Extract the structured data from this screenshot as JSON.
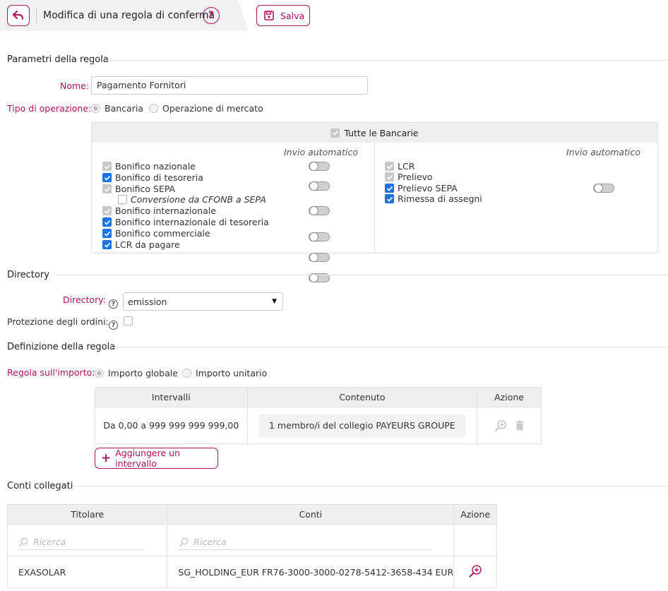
{
  "header": {
    "title": "Modifica di una regola di conferma",
    "help_icon_glyph": "?",
    "save_label": "Salva"
  },
  "rule_params": {
    "section_title": "Parametri della regola",
    "name_label": "Nome:",
    "name_value": "Pagamento Fornitori",
    "op_type_label": "Tipo di operazione:",
    "op_type_options": [
      "Bancaria",
      "Operazione di mercato"
    ],
    "op_type_selected": "Bancaria"
  },
  "operations": {
    "all_label": "Tutte le Bancarie",
    "invio_label": "Invio automatico",
    "left": [
      {
        "label": "Bonifico nazionale",
        "state": "disabled",
        "toggle": true
      },
      {
        "label": "Bonifico di tesoreria",
        "state": "checked",
        "toggle": true
      },
      {
        "label": "Bonifico SEPA",
        "state": "disabled",
        "toggle": true
      },
      {
        "label": "Conversione da CFONB a SEPA",
        "state": "empty",
        "toggle": false
      },
      {
        "label": "Bonifico internazionale",
        "state": "disabled",
        "toggle": true
      },
      {
        "label": "Bonifico internazionale di tesoreria",
        "state": "checked",
        "toggle": true
      },
      {
        "label": "Bonifico commerciale",
        "state": "checked",
        "toggle": true
      },
      {
        "label": "LCR da pagare",
        "state": "checked",
        "toggle": false
      }
    ],
    "right": [
      {
        "label": "LCR",
        "state": "disabled",
        "toggle": false
      },
      {
        "label": "Prelievo",
        "state": "disabled",
        "toggle": false
      },
      {
        "label": "Prelievo SEPA",
        "state": "checked",
        "toggle": true
      },
      {
        "label": "Rimessa di assegni",
        "state": "checked",
        "toggle": false
      }
    ]
  },
  "directory": {
    "section_title": "Directory",
    "directory_label": "Directory:",
    "directory_value": "emission",
    "protection_label": "Protezione degli ordini:",
    "help_glyph": "?"
  },
  "definition": {
    "section_title": "Definizione della regola",
    "amount_rule_label": "Regola sull'importo:",
    "amount_options": [
      "Importo globale",
      "Importo unitario"
    ],
    "amount_selected": "Importo globale",
    "table_headers": [
      "Intervalli",
      "Contenuto",
      "Azione"
    ],
    "rows": [
      {
        "interval": "Da 0,00 a 999 999 999 999,00",
        "content": "1 membro/i del collegio PAYEURS GROUPE"
      }
    ],
    "add_label": "Aggiungere un intervallo"
  },
  "accounts": {
    "section_title": "Conti collegati",
    "table_headers": [
      "Titolare",
      "Conti",
      "Azione"
    ],
    "search_placeholder": "Ricerca",
    "rows": [
      {
        "holder": "EXASOLAR",
        "account": "SG_HOLDING_EUR FR76-3000-3000-0278-5412-3658-434 EUR"
      }
    ]
  },
  "colors": {
    "accent": "#b0105f",
    "checkbox_checked": "#1a73e8",
    "checkbox_disabled": "#c8c8c8"
  }
}
